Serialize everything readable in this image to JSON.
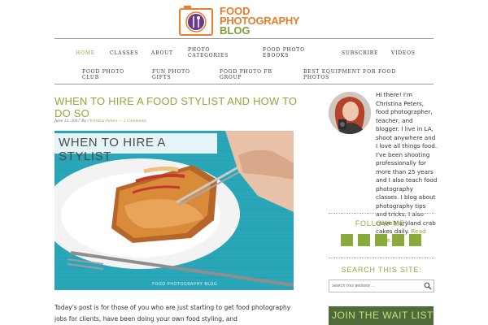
{
  "logo": {
    "line1": "FOOD",
    "line2": "PHOTOGRAPHY",
    "line3": "BLOG"
  },
  "nav": {
    "row1": [
      "HOME",
      "CLASSES",
      "ABOUT",
      "PHOTO\nCATEGORIES",
      "FOOD PHOTO\nEBOOKS",
      "SUBSCRIBE",
      "VIDEOS"
    ],
    "row2": [
      "FOOD PHOTO\nCLUB",
      "FUN PHOTO\nGIFTS",
      "FOOD PHOTO FB\nGROUP",
      "BEST EQUIPMENT FOR FOOD\nPHOTOS"
    ]
  },
  "post": {
    "title": "WHEN TO HIRE A FOOD STYLIST AND HOW TO DO SO",
    "date": "June 12, 2017",
    "by": "By",
    "author": "Christina Peters",
    "comments": "— 2 Comments",
    "image_banner": "WHEN TO HIRE A STYLIST",
    "image_watermark": "FOOD PHOTOGRAPHY BLOG",
    "intro": "Today's post is for those of you who are just starting to get food photography jobs for clients, have been doing your own food styling, and"
  },
  "sidebar": {
    "about_text": "Hi there! I'm Christina Peters, food photographer, teacher, and blogger. I live in LA, shoot anywhere and I love all things food. I've been shooting professionally for more than 25 years and I also teach food photography classes. I blog about photography tips and tricks. I also crave Maryland crab cakes daily.",
    "read_more": "Read More...",
    "follow_heading": "FOLLOW ME!",
    "social_icons": [
      "facebook-icon",
      "twitter-icon",
      "pinterest-icon",
      "instagram-icon",
      "youtube-icon"
    ],
    "search_heading": "SEARCH THIS SITE:",
    "search_placeholder": "Search this website ...",
    "waitlist": "JOIN THE WAIT LIST!"
  },
  "colors": {
    "accent_green": "#8aab3c",
    "logo_orange": "#e87d2b",
    "hero_teal": "#2aa6b9"
  }
}
